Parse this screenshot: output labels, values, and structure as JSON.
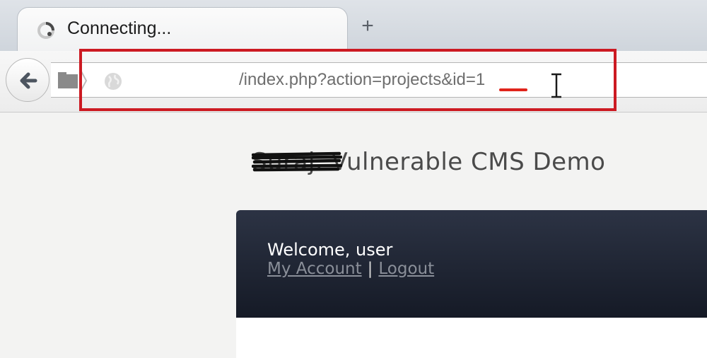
{
  "browser": {
    "tab": {
      "title": "Connecting...",
      "status_icon": "loading-spinner-icon"
    },
    "new_tab_label": "+",
    "url": {
      "prefix": "/index.php?action=projects&id=",
      "id_value": "1"
    },
    "icons": {
      "back": "back-arrow-icon",
      "identity": "folder-icon",
      "site": "globe-icon",
      "cursor": "text-cursor-icon"
    },
    "annotation": {
      "box_color": "#cc1a22",
      "underline_color": "#e0241b"
    }
  },
  "page": {
    "site_title": {
      "redacted": "Suraj.",
      "rest": " Vulnerable CMS Demo"
    },
    "panel": {
      "welcome": "Welcome, user",
      "my_account": "My Account",
      "separator": "|",
      "logout": "Logout"
    }
  }
}
